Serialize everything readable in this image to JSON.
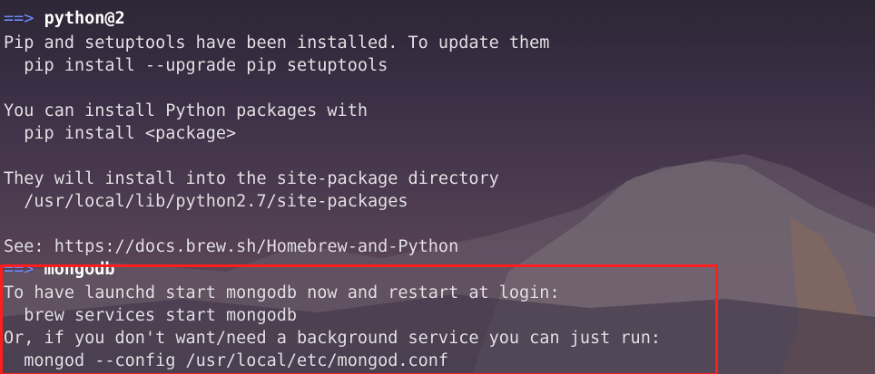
{
  "terminal": {
    "sections": [
      {
        "arrow": "==>",
        "package": "python@2",
        "lines": [
          "Pip and setuptools have been installed. To update them",
          "  pip install --upgrade pip setuptools",
          "",
          "You can install Python packages with",
          "  pip install <package>",
          "",
          "They will install into the site-package directory",
          "  /usr/local/lib/python2.7/site-packages",
          "",
          "See: https://docs.brew.sh/Homebrew-and-Python"
        ]
      },
      {
        "arrow": "==>",
        "package": "mongodb",
        "lines": [
          "To have launchd start mongodb now and restart at login:",
          "  brew services start mongodb",
          "Or, if you don't want/need a background service you can just run:",
          "  mongod --config /usr/local/etc/mongod.conf"
        ]
      }
    ]
  },
  "colors": {
    "arrow": "#6f8cff",
    "text": "#e6e1e7",
    "highlight": "#ff1e1e"
  }
}
